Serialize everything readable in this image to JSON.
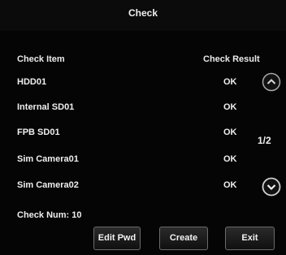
{
  "dialog": {
    "title": "Check"
  },
  "table": {
    "headers": {
      "item": "Check Item",
      "result": "Check Result"
    },
    "rows": [
      {
        "name": "HDD01",
        "result": "OK"
      },
      {
        "name": "Internal SD01",
        "result": "OK"
      },
      {
        "name": "FPB SD01",
        "result": "OK"
      },
      {
        "name": "Sim Camera01",
        "result": "OK"
      },
      {
        "name": "Sim Camera02",
        "result": "OK"
      }
    ]
  },
  "pagination": {
    "indicator": "1/2",
    "up_icon": "chevron-up-icon",
    "down_icon": "chevron-down-icon"
  },
  "footer": {
    "check_num": "Check Num: 10"
  },
  "buttons": {
    "edit_pwd": "Edit Pwd",
    "create": "Create",
    "exit": "Exit"
  }
}
